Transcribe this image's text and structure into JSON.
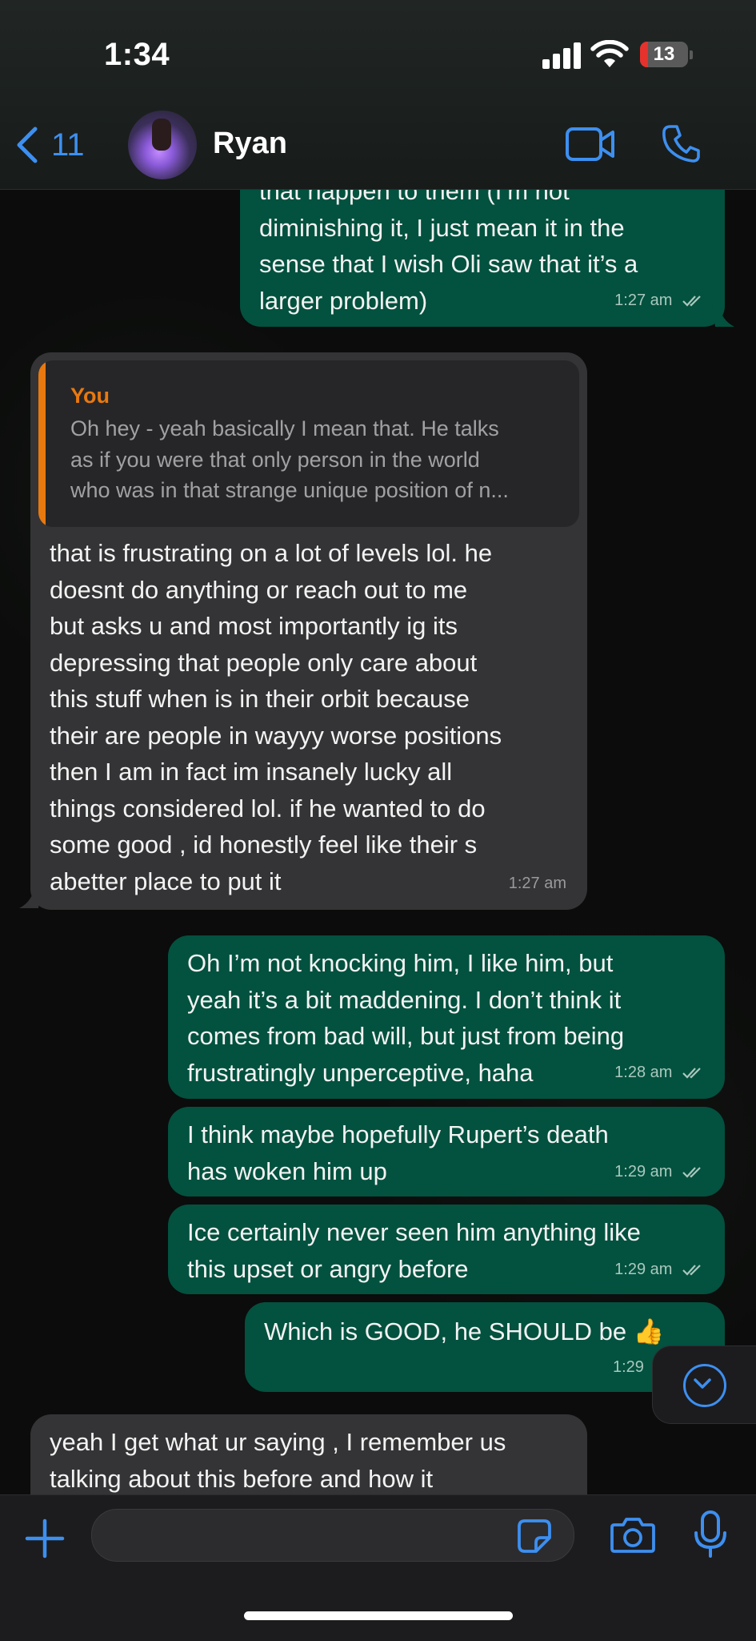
{
  "status_bar": {
    "time": "1:34",
    "battery_level": "13",
    "battery_color": "#e5322d"
  },
  "header": {
    "back_count": "11",
    "contact_name": "Ryan",
    "icons": [
      "chevron-left-icon",
      "video-camera-icon",
      "phone-icon"
    ],
    "accent_color": "#3d8ff0"
  },
  "messages": [
    {
      "direction": "outgoing",
      "text": "that happen to them (I’m not\ndiminishing it, I just mean it in the\nsense that I wish Oli saw that it’s a\nlarger problem)",
      "time": "1:27 am",
      "status": "read"
    },
    {
      "direction": "incoming",
      "quote_author": "You",
      "quote_text": "Oh hey - yeah basically I mean that. He talks\nas if you were that only person in the world\nwho was in that strange unique position of n...",
      "text": "that is frustrating on a lot of levels lol. he\ndoesnt do anything or reach out to me\nbut asks u and most importantly ig its\ndepressing that people only care about\nthis stuff when is in their orbit because\ntheir are people in wayyy worse positions\nthen I am in fact im insanely lucky all\nthings considered lol. if he wanted to do\nsome good ,  id honestly feel like their s\nabetter place to put it",
      "time": "1:27 am"
    },
    {
      "direction": "outgoing",
      "text": "Oh I’m not knocking him, I like him, but\nyeah it’s a bit maddening. I don’t think it\ncomes from bad will, but just from being\nfrustratingly unperceptive, haha",
      "time": "1:28 am",
      "status": "read"
    },
    {
      "direction": "outgoing",
      "text": "I think maybe hopefully Rupert’s death\nhas woken him up",
      "time": "1:29 am",
      "status": "read"
    },
    {
      "direction": "outgoing",
      "text": "Ice certainly never seen him anything like\nthis upset or angry before",
      "time": "1:29 am",
      "status": "read"
    },
    {
      "direction": "outgoing",
      "text": "Which is GOOD, he SHOULD be 👍",
      "time": "1:29",
      "status": "read"
    },
    {
      "direction": "incoming",
      "text": "yeah I get what ur saying , I remember us\ntalking about this before and how it",
      "time": ""
    }
  ],
  "composer": {
    "placeholder": "",
    "icons": [
      "plus-icon",
      "sticker-icon",
      "camera-icon",
      "microphone-icon"
    ]
  },
  "colors": {
    "outgoing_bubble": "#03513f",
    "incoming_bubble": "#343436",
    "quote_accent": "#e8790f",
    "chat_background": "#0b0c0b"
  }
}
